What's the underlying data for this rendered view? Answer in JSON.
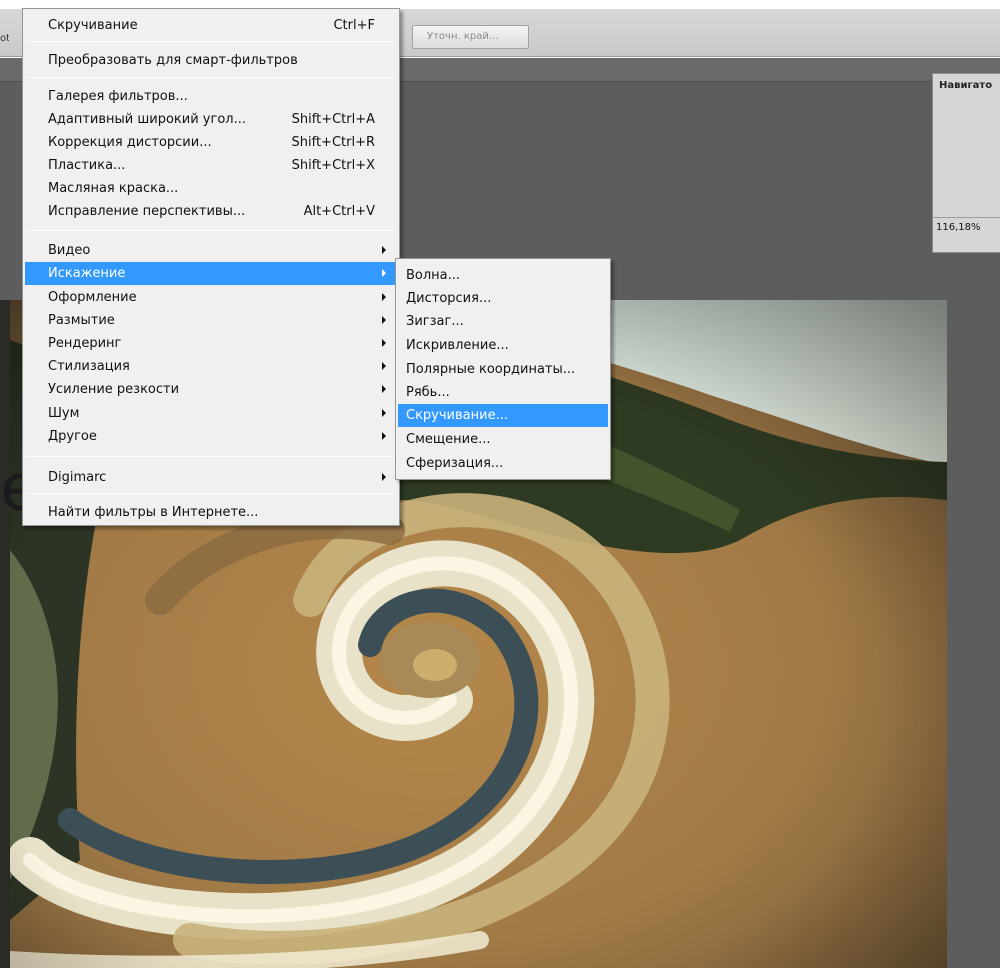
{
  "options_bar": {
    "left_clipped_text": "ot",
    "refine_edge_label": "Уточн. край..."
  },
  "navigator": {
    "title": "Навигато",
    "zoom": "116,18%"
  },
  "watermark_glyph": "е",
  "filter_menu": {
    "items": [
      {
        "label": "Скручивание",
        "shortcut": "Ctrl+F"
      },
      {
        "label": "Преобразовать для смарт-фильтров"
      },
      {
        "label": "Галерея фильтров..."
      },
      {
        "label": "Адаптивный широкий угол...",
        "shortcut": "Shift+Ctrl+A"
      },
      {
        "label": "Коррекция дисторсии...",
        "shortcut": "Shift+Ctrl+R"
      },
      {
        "label": "Пластика...",
        "shortcut": "Shift+Ctrl+X"
      },
      {
        "label": "Масляная краска..."
      },
      {
        "label": "Исправление перспективы...",
        "shortcut": "Alt+Ctrl+V"
      },
      {
        "label": "Видео"
      },
      {
        "label": "Искажение"
      },
      {
        "label": "Оформление"
      },
      {
        "label": "Размытие"
      },
      {
        "label": "Рендеринг"
      },
      {
        "label": "Стилизация"
      },
      {
        "label": "Усиление резкости"
      },
      {
        "label": "Шум"
      },
      {
        "label": "Другое"
      },
      {
        "label": "Digimarc"
      },
      {
        "label": "Найти фильтры в Интернете..."
      }
    ],
    "highlighted": "Искажение"
  },
  "distort_submenu": {
    "items": [
      {
        "label": "Волна..."
      },
      {
        "label": "Дисторсия..."
      },
      {
        "label": "Зигзаг..."
      },
      {
        "label": "Искривление..."
      },
      {
        "label": "Полярные координаты..."
      },
      {
        "label": "Рябь..."
      },
      {
        "label": "Скручивание..."
      },
      {
        "label": "Смещение..."
      },
      {
        "label": "Сферизация..."
      }
    ],
    "highlighted": "Скручивание..."
  },
  "colors": {
    "menu_highlight": "#3399ff",
    "menu_background": "#f0f0f0",
    "workspace": "#5d5d5d"
  },
  "icons": [
    "submenu-arrow-icon"
  ]
}
